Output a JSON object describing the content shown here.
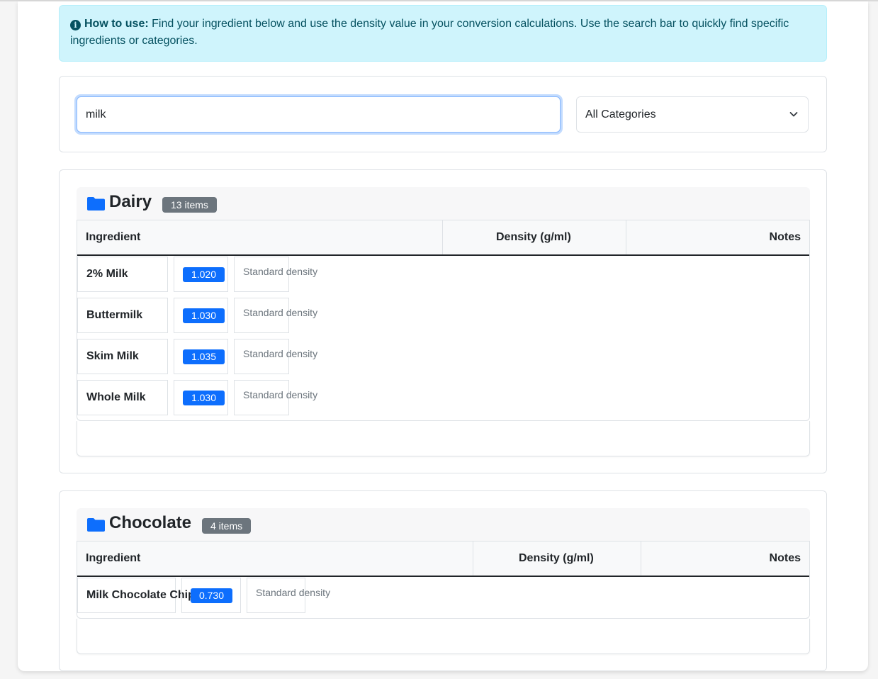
{
  "help": {
    "label": "How to use:",
    "text": " Find your ingredient below and use the density value in your conversion calculations. Use the search bar to quickly find specific ingredients or categories."
  },
  "search": {
    "value": "milk",
    "category_selected": "All Categories"
  },
  "columns": {
    "ingredient": "Ingredient",
    "density": "Density (g/ml)",
    "notes": "Notes"
  },
  "categories": [
    {
      "name": "Dairy",
      "count": "13 items",
      "rows": [
        {
          "name": "2% Milk",
          "density": "1.020",
          "note": "Standard density"
        },
        {
          "name": "Buttermilk",
          "density": "1.030",
          "note": "Standard density"
        },
        {
          "name": "Skim Milk",
          "density": "1.035",
          "note": "Standard density"
        },
        {
          "name": "Whole Milk",
          "density": "1.030",
          "note": "Standard density"
        }
      ]
    },
    {
      "name": "Chocolate",
      "count": "4 items",
      "rows": [
        {
          "name": "Milk Chocolate Chips",
          "density": "0.730",
          "note": "Standard density"
        }
      ]
    }
  ],
  "colors": {
    "accent": "#0d6efd",
    "badge": "#6c757d",
    "info_bg": "#cff4fc",
    "info_text": "#055160"
  },
  "icons": {
    "info": "info-circle-icon",
    "folder": "folder-icon",
    "select": "chevron-down-icon"
  }
}
